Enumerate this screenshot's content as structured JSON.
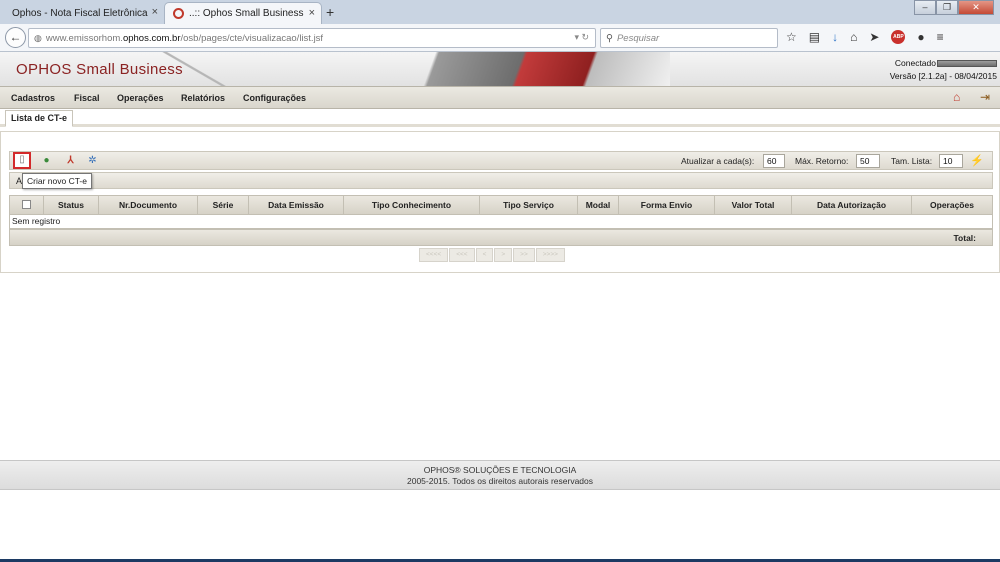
{
  "browser": {
    "tabs": [
      {
        "label": "Ophos - Nota Fiscal Eletrônica",
        "close": "×"
      },
      {
        "label": "..:: Ophos Small Business",
        "close": "×"
      }
    ],
    "new_tab": "+",
    "window_buttons": {
      "minimize": "–",
      "restore": "❐",
      "close": "✕"
    },
    "url": {
      "prefix": "www.emissorhom.",
      "domain": "ophos.com.br",
      "path": "/osb/pages/cte/visualizacao/list.jsf"
    },
    "search_placeholder": "Pesquisar",
    "addon_badge": "ABP"
  },
  "app": {
    "logo": "OPHOS Small Business",
    "status_label": "Conectado",
    "version": "Versão [2.1.2a] - 08/04/2015"
  },
  "menu": {
    "items": [
      "Cadastros",
      "Fiscal",
      "Operações",
      "Relatórios",
      "Configurações"
    ]
  },
  "page_tab": "Lista de CT-e",
  "toolbar": {
    "refresh_label": "Atualizar a cada(s):",
    "refresh_value": "60",
    "max_label": "Máx. Retorno:",
    "max_value": "50",
    "size_label": "Tam. Lista:",
    "size_value": "10"
  },
  "tooltip": "Criar novo CT-e",
  "subbar_char": "A",
  "grid": {
    "columns": [
      "Status",
      "Nr.Documento",
      "Série",
      "Data Emissão",
      "Tipo Conhecimento",
      "Tipo Serviço",
      "Modal",
      "Forma Envio",
      "Valor Total",
      "Data Autorização",
      "Operações"
    ],
    "empty_text": "Sem registro",
    "total_label": "Total:"
  },
  "pager": [
    "<<<<",
    "<<<",
    "<",
    ">",
    ">>",
    ">>>>"
  ],
  "footer": {
    "line1": "OPHOS® SOLUÇÕES E TECNOLOGIA",
    "line2": "2005-2015. Todos os direitos autorais reservados"
  },
  "colors": {
    "accent_logo": "#8b2323",
    "highlight_border": "#d32a2a",
    "header_band": "#dedad0"
  }
}
